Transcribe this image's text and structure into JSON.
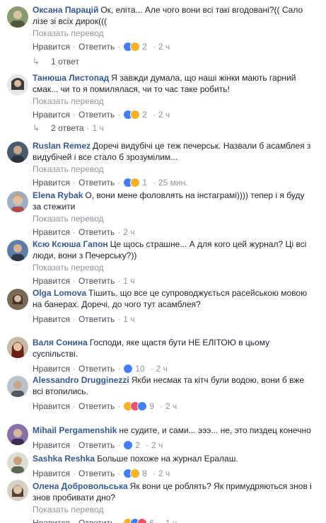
{
  "ui": {
    "translate": "Показать перевод",
    "like": "Нравится",
    "reply": "Ответить",
    "dot": "·"
  },
  "comments": [
    {
      "author": "Оксана Парацій",
      "text": "Ок, еліта... Але чого вони всі такі вгодовані?(( Сало лізе зі всіх дирок(((",
      "reactions": [
        "like",
        "wow"
      ],
      "count": "2",
      "time": "2 ч",
      "replies": "1 ответ",
      "avatar_color": "#8a9b6e"
    },
    {
      "author": "Танюша Листопад",
      "text": "Я завжди думала, що наші жінки мають гарний смак... чи то я помилялася, чи то час таке робить!",
      "reactions": [
        "like",
        "wow"
      ],
      "count": "2",
      "time": "2 ч",
      "replies": "2 ответа",
      "replies_time": "1 ч",
      "avatar_color": "#6b6b6b"
    },
    {
      "author": "Ruslan Remez",
      "text": "Доречі видубічі це теж печерськ. Назвали б асамблея з видубічей і все стало б зрозумілим...",
      "reactions": [
        "like",
        "haha"
      ],
      "count": "1",
      "time": "25 мин.",
      "avatar_color": "#4a5a70"
    },
    {
      "author": "Elena Rybak",
      "text": "О, вони мене фоловлять на інстаграмі)))) тепер і я буду за стежити",
      "reactions": [],
      "count": "",
      "time": "2 ч",
      "avatar_color": "#c9a07a"
    },
    {
      "author": "Ксю Ксюша Гапон",
      "text": "Це щось страшне... А для кого цей журнал? Ці всі люди, вони з Печерську?))",
      "reactions": [],
      "count": "",
      "time": "1 ч",
      "avatar_color": "#5b7fa8"
    },
    {
      "author": "Olga Lomova",
      "text": "Тішить, що все це супроводжується расейською мовою на банерах. Доречі, до чого тут асамблея?",
      "reactions": [],
      "count": "",
      "time": "1 ч",
      "avatar_color": "#7a6a55"
    },
    {
      "author": "Валя Сонина",
      "text": "Господи, яке щастя бути НЕ ЕЛІТОЮ в цьому суспільстві.",
      "reactions": [
        "like"
      ],
      "count": "10",
      "time": "2 ч",
      "avatar_color": "#a04030"
    },
    {
      "author": "Alessandro Drugginezzi",
      "text": "Якби несмак та кітч були водою, вони б вже всі втопились.",
      "reactions": [
        "haha",
        "heart",
        "like"
      ],
      "count": "9",
      "time": "2 ч",
      "avatar_color": "#8a8a8a"
    },
    {
      "author": "Mihail Pergamenshik",
      "text": "не судите, и сами... эээ... не, это пиздец конечно",
      "reactions": [
        "like"
      ],
      "count": "2",
      "time": "2 ч",
      "avatar_color": "#8a70a8"
    },
    {
      "author": "Sashka Reshka",
      "text": "Больше похоже на журнал Ералаш.",
      "reactions": [
        "like",
        "haha"
      ],
      "count": "8",
      "time": "2 ч",
      "avatar_color": "#5a6a50"
    },
    {
      "author": "Олена Добровольська",
      "text": "Як вони це роблять? Як примудряються знов і знов пробивати дно?",
      "reactions": [
        "haha",
        "like",
        "heart"
      ],
      "count": "6",
      "time": "1 ч",
      "avatar_color": "#b08a70"
    }
  ]
}
